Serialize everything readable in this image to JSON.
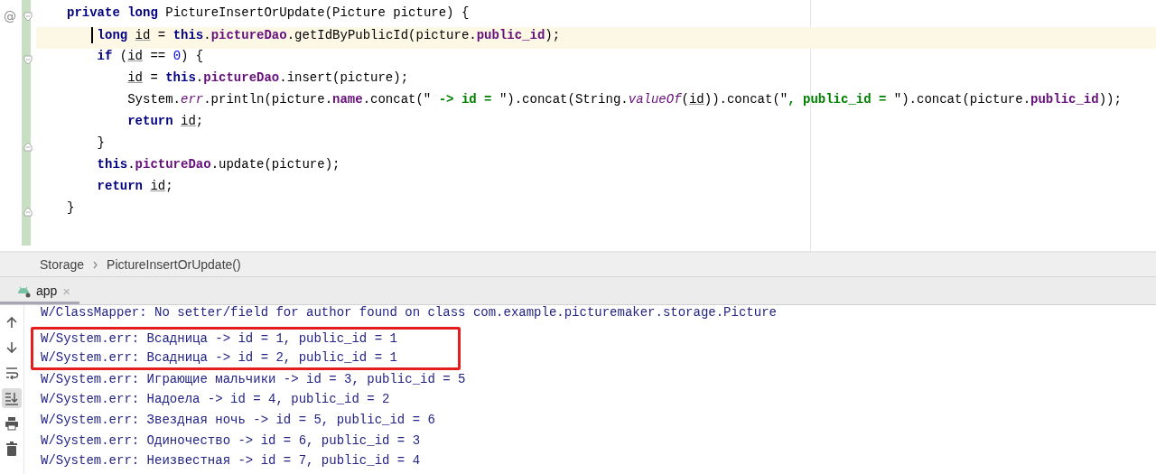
{
  "editor": {
    "lines": [
      {
        "gutter_mark": "@",
        "kind": "block-start",
        "current": false,
        "segments": [
          {
            "text": "private long",
            "kind": "kw"
          },
          {
            "text": " PictureInsertOrUpdate(Picture picture) {",
            "kind": "plain"
          }
        ],
        "children": [
          {
            "current": true,
            "segments": [
              {
                "text": "long ",
                "kind": "kw"
              },
              {
                "text": "id",
                "kind": "local"
              },
              {
                "text": " = ",
                "kind": "plain"
              },
              {
                "text": "this",
                "kind": "kw"
              },
              {
                "text": ".",
                "kind": "plain"
              },
              {
                "text": "pictureDao",
                "kind": "field"
              },
              {
                "text": ".getIdByPublicId(picture.",
                "kind": "plain"
              },
              {
                "text": "public_id",
                "kind": "field"
              },
              {
                "text": ");",
                "kind": "plain"
              }
            ]
          },
          {
            "kind": "block-start",
            "current": false,
            "segments": [
              {
                "text": "if",
                "kind": "kw"
              },
              {
                "text": " (",
                "kind": "plain"
              },
              {
                "text": "id",
                "kind": "local"
              },
              {
                "text": " == ",
                "kind": "plain"
              },
              {
                "text": "0",
                "kind": "num"
              },
              {
                "text": ") {",
                "kind": "plain"
              }
            ],
            "children": [
              {
                "current": false,
                "segments": [
                  {
                    "text": "id",
                    "kind": "local"
                  },
                  {
                    "text": " = ",
                    "kind": "plain"
                  },
                  {
                    "text": "this",
                    "kind": "kw"
                  },
                  {
                    "text": ".",
                    "kind": "plain"
                  },
                  {
                    "text": "pictureDao",
                    "kind": "field"
                  },
                  {
                    "text": ".insert(picture);",
                    "kind": "plain"
                  }
                ]
              },
              {
                "current": false,
                "segments": [
                  {
                    "text": "System.",
                    "kind": "plain"
                  },
                  {
                    "text": "err",
                    "kind": "static"
                  },
                  {
                    "text": ".println(picture.",
                    "kind": "plain"
                  },
                  {
                    "text": "name",
                    "kind": "field"
                  },
                  {
                    "text": ".concat(\"",
                    "kind": "plain"
                  },
                  {
                    "text": " -> id = ",
                    "kind": "str"
                  },
                  {
                    "text": "\").concat(String.",
                    "kind": "plain"
                  },
                  {
                    "text": "valueOf",
                    "kind": "static"
                  },
                  {
                    "text": "(",
                    "kind": "plain"
                  },
                  {
                    "text": "id",
                    "kind": "local"
                  },
                  {
                    "text": ")).concat(\"",
                    "kind": "plain"
                  },
                  {
                    "text": ", public_id = ",
                    "kind": "str"
                  },
                  {
                    "text": "\").concat(picture.",
                    "kind": "plain"
                  },
                  {
                    "text": "public_id",
                    "kind": "field"
                  },
                  {
                    "text": "));",
                    "kind": "plain"
                  }
                ]
              },
              {
                "current": false,
                "segments": [
                  {
                    "text": "return ",
                    "kind": "kw"
                  },
                  {
                    "text": "id",
                    "kind": "local"
                  },
                  {
                    "text": ";",
                    "kind": "plain"
                  }
                ]
              }
            ]
          },
          {
            "kind": "block-end",
            "current": false,
            "segments": [
              {
                "text": "}",
                "kind": "plain"
              }
            ]
          },
          {
            "current": false,
            "segments": [
              {
                "text": "this",
                "kind": "kw"
              },
              {
                "text": ".",
                "kind": "plain"
              },
              {
                "text": "pictureDao",
                "kind": "field"
              },
              {
                "text": ".update(picture);",
                "kind": "plain"
              }
            ]
          },
          {
            "current": false,
            "segments": [
              {
                "text": "return ",
                "kind": "kw"
              },
              {
                "text": "id",
                "kind": "local"
              },
              {
                "text": ";",
                "kind": "plain"
              }
            ]
          }
        ]
      },
      {
        "kind": "block-end",
        "current": false,
        "segments": [
          {
            "text": "}",
            "kind": "plain"
          }
        ]
      }
    ]
  },
  "breadcrumbs": [
    "Storage",
    "PictureInsertOrUpdate()"
  ],
  "run_window": {
    "tab": {
      "label": "app",
      "close": "×",
      "selected": true
    },
    "toolbar": [
      {
        "kind": "up",
        "on": false
      },
      {
        "kind": "down",
        "on": false
      },
      {
        "kind": "wrap",
        "on": false
      },
      {
        "kind": "scroll-end",
        "on": true
      },
      {
        "kind": "print",
        "on": false
      },
      {
        "kind": "trash",
        "on": false
      }
    ],
    "log": [
      {
        "text": "W/ClassMapper: No setter/field for author found on class com.example.picturemaker.storage.Picture",
        "boxed": false
      },
      {
        "text": "W/System.err: Всадница -> id = 1, public_id = 1",
        "boxed": true
      },
      {
        "text": "W/System.err: Всадница -> id = 2, public_id = 1",
        "boxed": true
      },
      {
        "text": "W/System.err: Играющие мальчики -> id = 3, public_id = 5",
        "boxed": false
      },
      {
        "text": "W/System.err: Надоела -> id = 4, public_id = 2",
        "boxed": false
      },
      {
        "text": "W/System.err: Звездная ночь -> id = 5, public_id = 6",
        "boxed": false
      },
      {
        "text": "W/System.err: Одиночество -> id = 6, public_id = 3",
        "boxed": false
      },
      {
        "text": "W/System.err: Неизвестная -> id = 7, public_id = 4",
        "boxed": false
      }
    ]
  }
}
